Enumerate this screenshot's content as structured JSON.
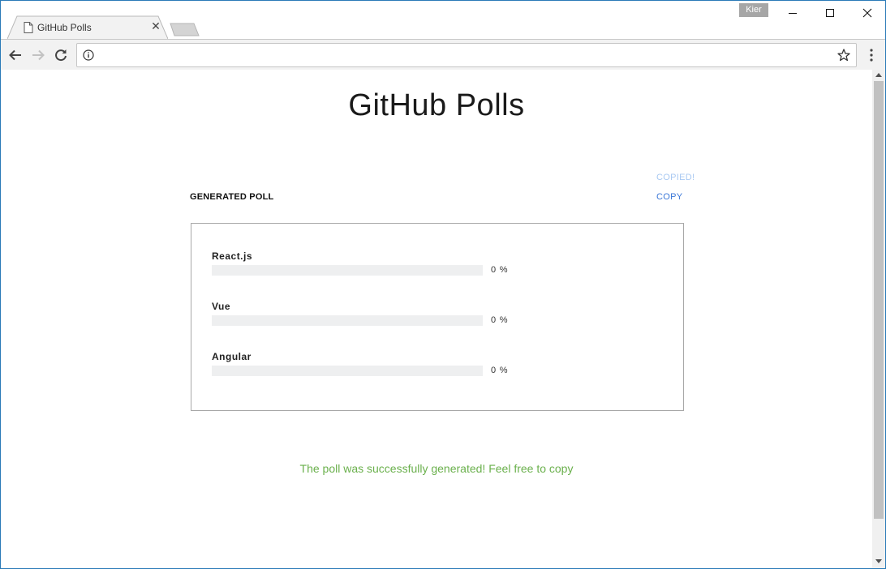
{
  "browser": {
    "tab_title": "GitHub Polls",
    "profile_name": "Kier",
    "url": ""
  },
  "page": {
    "title": "GitHub Polls",
    "section_label": "GENERATED POLL",
    "copied_label": "COPIED!",
    "copy_label": "COPY",
    "success_message": "The poll was successfully generated! Feel free to copy"
  },
  "poll": {
    "options": [
      {
        "label": "React.js",
        "percent_text": "0 %",
        "percent": 0
      },
      {
        "label": "Vue",
        "percent_text": "0 %",
        "percent": 0
      },
      {
        "label": "Angular",
        "percent_text": "0 %",
        "percent": 0
      }
    ]
  },
  "colors": {
    "accent": "#3c78d8",
    "copied": "#a9c9f2",
    "success": "#6ab04c",
    "window_border": "#2a7ab8"
  },
  "icons": {
    "tab": "document-icon",
    "close_tab": "close-icon",
    "back": "arrow-left-icon",
    "forward": "arrow-right-icon",
    "reload": "reload-icon",
    "site_info": "info-icon",
    "bookmark": "star-icon",
    "menu": "kebab-menu-icon"
  }
}
